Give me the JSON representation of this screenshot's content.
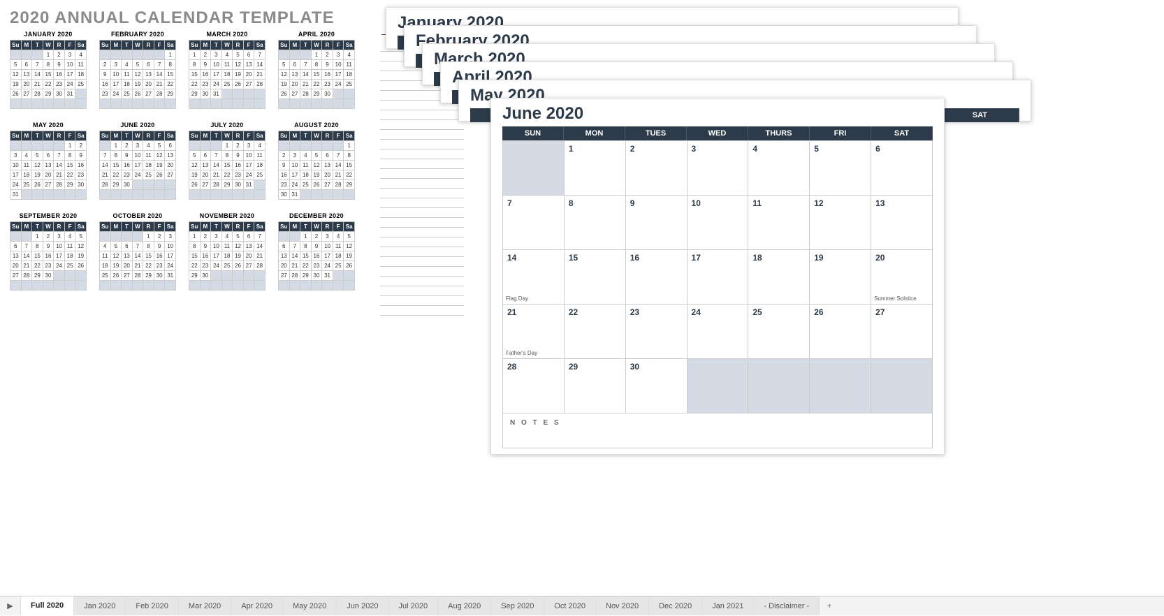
{
  "title": "2020 ANNUAL CALENDAR TEMPLATE",
  "notes_label": "— N O T E S —",
  "day_short": [
    "Su",
    "M",
    "T",
    "W",
    "R",
    "F",
    "Sa"
  ],
  "day_long": [
    "SUN",
    "MON",
    "TUES",
    "WED",
    "THURS",
    "FRI",
    "SAT"
  ],
  "mini_months": [
    {
      "name": "JANUARY 2020",
      "start": 3,
      "days": 31
    },
    {
      "name": "FEBRUARY 2020",
      "start": 6,
      "days": 29
    },
    {
      "name": "MARCH 2020",
      "start": 0,
      "days": 31
    },
    {
      "name": "APRIL 2020",
      "start": 3,
      "days": 30
    },
    {
      "name": "MAY 2020",
      "start": 5,
      "days": 31
    },
    {
      "name": "JUNE 2020",
      "start": 1,
      "days": 30
    },
    {
      "name": "JULY 2020",
      "start": 3,
      "days": 31
    },
    {
      "name": "AUGUST 2020",
      "start": 6,
      "days": 31
    },
    {
      "name": "SEPTEMBER 2020",
      "start": 2,
      "days": 30
    },
    {
      "name": "OCTOBER 2020",
      "start": 4,
      "days": 31
    },
    {
      "name": "NOVEMBER 2020",
      "start": 0,
      "days": 30
    },
    {
      "name": "DECEMBER 2020",
      "start": 2,
      "days": 31
    }
  ],
  "stack_sheets": [
    {
      "title": "January 2020"
    },
    {
      "title": "February 2020"
    },
    {
      "title": "March 2020"
    },
    {
      "title": "April 2020"
    },
    {
      "title": "May 2020"
    }
  ],
  "front_sheet": {
    "title": "June 2020",
    "start": 1,
    "days": 30,
    "events": {
      "14": "Flag Day",
      "20": "Summer Solstice",
      "21": "Father's Day"
    },
    "notes_label": "N O T E S"
  },
  "tabs": [
    "Full 2020",
    "Jan 2020",
    "Feb 2020",
    "Mar 2020",
    "Apr 2020",
    "May 2020",
    "Jun 2020",
    "Jul 2020",
    "Aug 2020",
    "Sep 2020",
    "Oct 2020",
    "Nov 2020",
    "Dec 2020",
    "Jan 2021",
    "- Disclaimer -"
  ],
  "active_tab": 0,
  "notes_line_count": 28
}
